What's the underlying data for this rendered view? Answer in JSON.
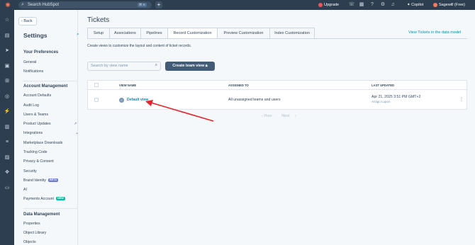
{
  "topbar": {
    "search_placeholder": "Search HubSpot",
    "search_shortcut": "⌘ K",
    "upgrade_label": "Upgrade",
    "copilot_label": "Copilot",
    "account_label": "Sagewill (Free)"
  },
  "sidebar": {
    "back_label": "Back",
    "title": "Settings",
    "sections": [
      {
        "heading": "Your Preferences",
        "items": [
          "General",
          "Notifications"
        ]
      },
      {
        "heading": "Account Management",
        "items": [
          "Account Defaults",
          "Audit Log",
          "Users & Teams",
          "Product Updates",
          "Integrations",
          "Marketplace Downloads",
          "Tracking Code",
          "Privacy & Consent",
          "Security",
          "Brand Identity",
          "AI",
          "Payments Account"
        ]
      },
      {
        "heading": "Data Management",
        "items": [
          "Properties",
          "Object Library",
          "Objects"
        ]
      }
    ],
    "badges": {
      "beta": "BETA",
      "new": "NEW"
    }
  },
  "page": {
    "title": "Tickets",
    "tabs": [
      "Setup",
      "Associations",
      "Pipelines",
      "Record Customization",
      "Preview Customization",
      "Index Customization"
    ],
    "active_tab": "Record Customization",
    "data_model_link": "View Tickets in the data model",
    "description": "Create views to customize the layout and content of ticket records.",
    "search_placeholder": "Search by view name",
    "create_button": "Create team view",
    "table": {
      "columns": [
        "VIEW NAME",
        "ASSIGNED TO",
        "LAST UPDATED"
      ],
      "rows": [
        {
          "name": "Default view",
          "assigned": "All unassigned teams and users",
          "updated": "Apr 21, 2025 3:51 PM GMT+2",
          "updated_by": "Antigo Lupon"
        }
      ]
    },
    "pagination": {
      "prev": "Prev",
      "next": "Next"
    }
  },
  "colors": {
    "accent": "#0091ae",
    "nav": "#2d3e50",
    "button": "#425b76",
    "annotation_arrow": "#e5242b"
  },
  "icons": [
    "hubspot-logo-icon",
    "search-icon",
    "plus-icon",
    "phone-icon",
    "marketplace-icon",
    "help-icon",
    "settings-icon",
    "bell-icon",
    "sparkle-icon",
    "lock-icon",
    "kebab-icon",
    "chevron-down-icon",
    "external-link-icon"
  ]
}
